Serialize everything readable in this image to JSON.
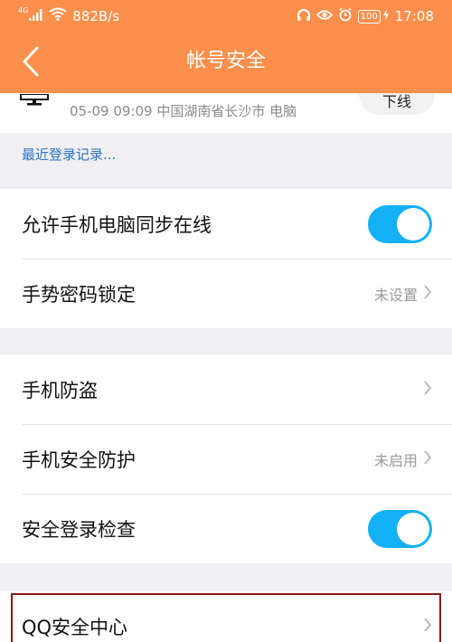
{
  "status_bar": {
    "signal_label": "4G",
    "net_speed": "882B/s",
    "battery": "100",
    "time": "17:08"
  },
  "nav": {
    "title": "帐号安全"
  },
  "device": {
    "meta": "05-09 09:09 中国湖南省长沙市 电脑",
    "offline_label": "下线"
  },
  "recent_link": "最近登录记录...",
  "group1": {
    "sync_online": {
      "label": "允许手机电脑同步在线",
      "toggle_on": true
    },
    "gesture_lock": {
      "label": "手势密码锁定",
      "value": "未设置"
    }
  },
  "group2": {
    "anti_theft": {
      "label": "手机防盗"
    },
    "security_protect": {
      "label": "手机安全防护",
      "value": "未启用"
    },
    "login_check": {
      "label": "安全登录检查",
      "toggle_on": true
    }
  },
  "group3": {
    "security_center": {
      "label": "QQ安全中心"
    }
  },
  "colors": {
    "header": "#fb8f4b",
    "toggle": "#13b0f5",
    "link": "#2c73c6",
    "highlight_border": "#8b1a1a"
  }
}
